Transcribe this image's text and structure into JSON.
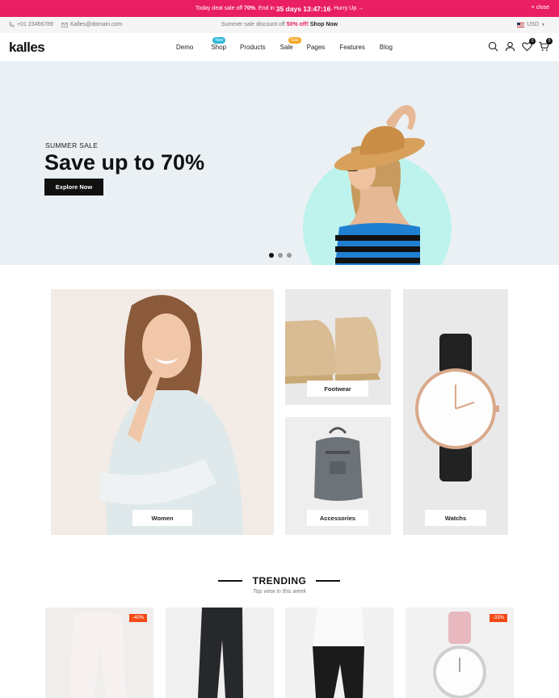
{
  "promo": {
    "prefix": "Today deal sale off",
    "percent": "70%",
    "mid": ". End in",
    "countdown": "35 days 13:47:16",
    "suffix": ". Hurry Up",
    "arrow": "→",
    "close_label": "close"
  },
  "infobar": {
    "phone": "+01 23456789",
    "email": "Kalles@domain.com",
    "notice_prefix": "Summer sale discount off",
    "notice_discount": "50% off!",
    "notice_link": "Shop Now",
    "currency": "USD"
  },
  "header": {
    "logo": "kalles",
    "nav": [
      {
        "label": "Demo"
      },
      {
        "label": "Shop",
        "badge": "New",
        "badge_color": "#2bb6d8"
      },
      {
        "label": "Products"
      },
      {
        "label": "Sale",
        "badge": "Sale",
        "badge_color": "#f6a623"
      },
      {
        "label": "Pages"
      },
      {
        "label": "Features"
      },
      {
        "label": "Blog"
      }
    ],
    "wishlist_count": "0",
    "cart_count": "0"
  },
  "hero": {
    "eyebrow": "SUMMER SALE",
    "headline": "Save up to 70%",
    "cta": "Explore Now",
    "slides": 3,
    "active_slide": 1
  },
  "collections": {
    "women": "Women",
    "footwear": "Footwear",
    "accessories": "Accessories",
    "watchs": "Watchs"
  },
  "trending": {
    "title": "TRENDING",
    "subtitle": "Top view in this week",
    "products": [
      {
        "badge": "-40%"
      },
      {
        "badge": ""
      },
      {
        "badge": ""
      },
      {
        "badge": "-33%"
      }
    ]
  },
  "colors": {
    "accent": "#e91e63",
    "sale": "#f44a16",
    "hero_bg": "#eaf0f3",
    "hero_circle": "#bdf3ec"
  }
}
